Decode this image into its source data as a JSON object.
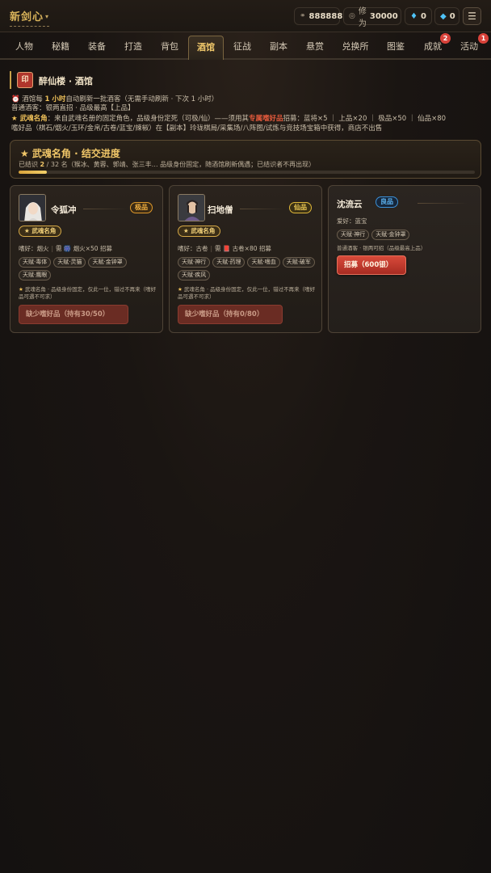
{
  "header": {
    "brand": "新剑心",
    "resources": [
      {
        "icon": "coin-icon",
        "label": "",
        "value": "888888"
      },
      {
        "icon": "cultivation-icon",
        "label": "修为",
        "value": "30000"
      },
      {
        "icon": "diamond-icon",
        "label": "",
        "value": "0"
      },
      {
        "icon": "crystal-icon",
        "label": "",
        "value": "0"
      }
    ],
    "menu_icon": "menu-icon"
  },
  "tabs": [
    {
      "label": "人物"
    },
    {
      "label": "秘籍"
    },
    {
      "label": "装备"
    },
    {
      "label": "打造"
    },
    {
      "label": "背包"
    },
    {
      "label": "酒馆",
      "active": true
    },
    {
      "label": "征战"
    },
    {
      "label": "副本"
    },
    {
      "label": "悬赏"
    },
    {
      "label": "兑换所"
    },
    {
      "label": "图鉴"
    },
    {
      "label": "成就",
      "badge": "2"
    },
    {
      "label": "活动",
      "badge": "1"
    }
  ],
  "section": {
    "seal": "印",
    "title": "醉仙楼 · 酒馆"
  },
  "info": {
    "line1_a": "酒馆每 ",
    "line1_hl": "1 小时",
    "line1_b": "自动刷新一批酒客（无需手动刷新 · 下次 1 小时）",
    "line2": "普通酒客：银两直招 · 品级最高【上品】",
    "line3_label": "★ 武魂名角",
    "line3_a": "：来自武魂名册的固定角色，品级身份定死（可极/仙）——须用其",
    "line3_hl": "专属嗜好品",
    "line3_b": "招募：蓝将×5 ｜ 上品×20 ｜ 极品×50 ｜ 仙品×80",
    "line4": "嗜好品（棋石/烟火/玉环/金帛/古卷/蓝宝/辣椒）在【副本】玲珑棋局/采集场/八阵图/试炼与竞技场宝箱中获得，商店不出售"
  },
  "progress": {
    "title": "★ 武魂名角 · 结交进度",
    "prefix": "已结识 ",
    "current": "2",
    "total_text": " / 32 名（猴冰、黄蓉、郭靖、张三丰… 品级身份固定，随酒馆刷新偶遇；已结识者不再出现）",
    "fraction": 0.0625
  },
  "cards": [
    {
      "name": "令狐冲",
      "rarity": "极品",
      "role": "★ 武魂名角",
      "hobby_label": "嗜好：烟火",
      "need": "需",
      "need_item": "烟火×50 招募",
      "traits": [
        "天赋·毒体",
        "天赋·灵猫",
        "天赋·金钟罩",
        "天赋·鹰眼"
      ],
      "note": "武魂名角 · 品级身份固定，仅此一位，错过不再来（嗜好品可遇不可求）",
      "button": "缺少嗜好品（持有30/50）"
    },
    {
      "name": "扫地僧",
      "rarity": "仙品",
      "role": "★ 武魂名角",
      "hobby_label": "嗜好：古卷",
      "need": "需",
      "need_item": "古卷×80 招募",
      "traits": [
        "天赋·神行",
        "天赋·药理",
        "天赋·嗜血",
        "天赋·破军",
        "天赋·疾风"
      ],
      "note": "武魂名角 · 品级身份固定，仅此一位，错过不再来（嗜好品可遇不可求）",
      "button": "缺少嗜好品（持有0/80）"
    },
    {
      "name": "沈流云",
      "rarity": "良品",
      "hobby_label": "爱好：蓝宝",
      "traits": [
        "天赋·神行",
        "天赋·金钟罩"
      ],
      "note": "普通酒客 · 银两可招（品级最高上品）",
      "button": "招募（600银）"
    }
  ],
  "colors": {
    "accent_gold": "#f0c668",
    "button_red": "#c0392b",
    "rarity_jipin": "#f2b040",
    "rarity_xianpin": "#f0cc55",
    "rarity_liangpin": "#5cb2f0"
  }
}
